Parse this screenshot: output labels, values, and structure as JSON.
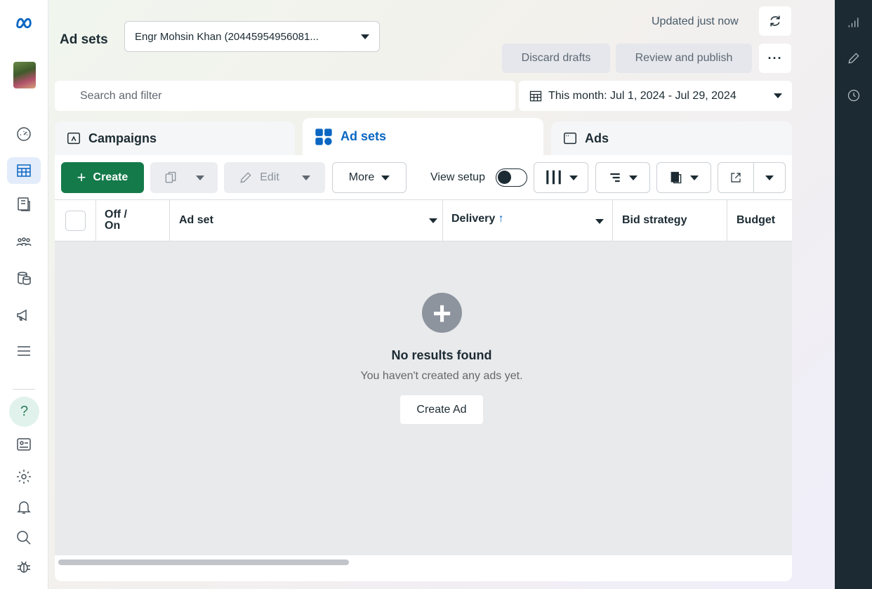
{
  "header": {
    "title": "Ad sets",
    "account": "Engr Mohsin Khan (20445954956081...",
    "updated": "Updated just now",
    "discard": "Discard drafts",
    "review": "Review and publish"
  },
  "search": {
    "placeholder": "Search and filter"
  },
  "date_range": {
    "label": "This month: Jul 1, 2024 - Jul 29, 2024"
  },
  "tabs": [
    {
      "label": "Campaigns"
    },
    {
      "label": "Ad sets"
    },
    {
      "label": "Ads"
    }
  ],
  "toolbar": {
    "create": "Create",
    "edit": "Edit",
    "more": "More",
    "view_setup": "View setup"
  },
  "table": {
    "columns": {
      "off_on": "Off / On",
      "ad_set": "Ad set",
      "delivery": "Delivery",
      "bid_strategy": "Bid strategy",
      "budget": "Budget"
    }
  },
  "empty_state": {
    "title": "No results found",
    "subtitle": "You haven't created any ads yet.",
    "button": "Create Ad"
  },
  "colors": {
    "accent": "#0a66c2",
    "create_green": "#147a4a",
    "right_rail": "#1c2b33"
  }
}
